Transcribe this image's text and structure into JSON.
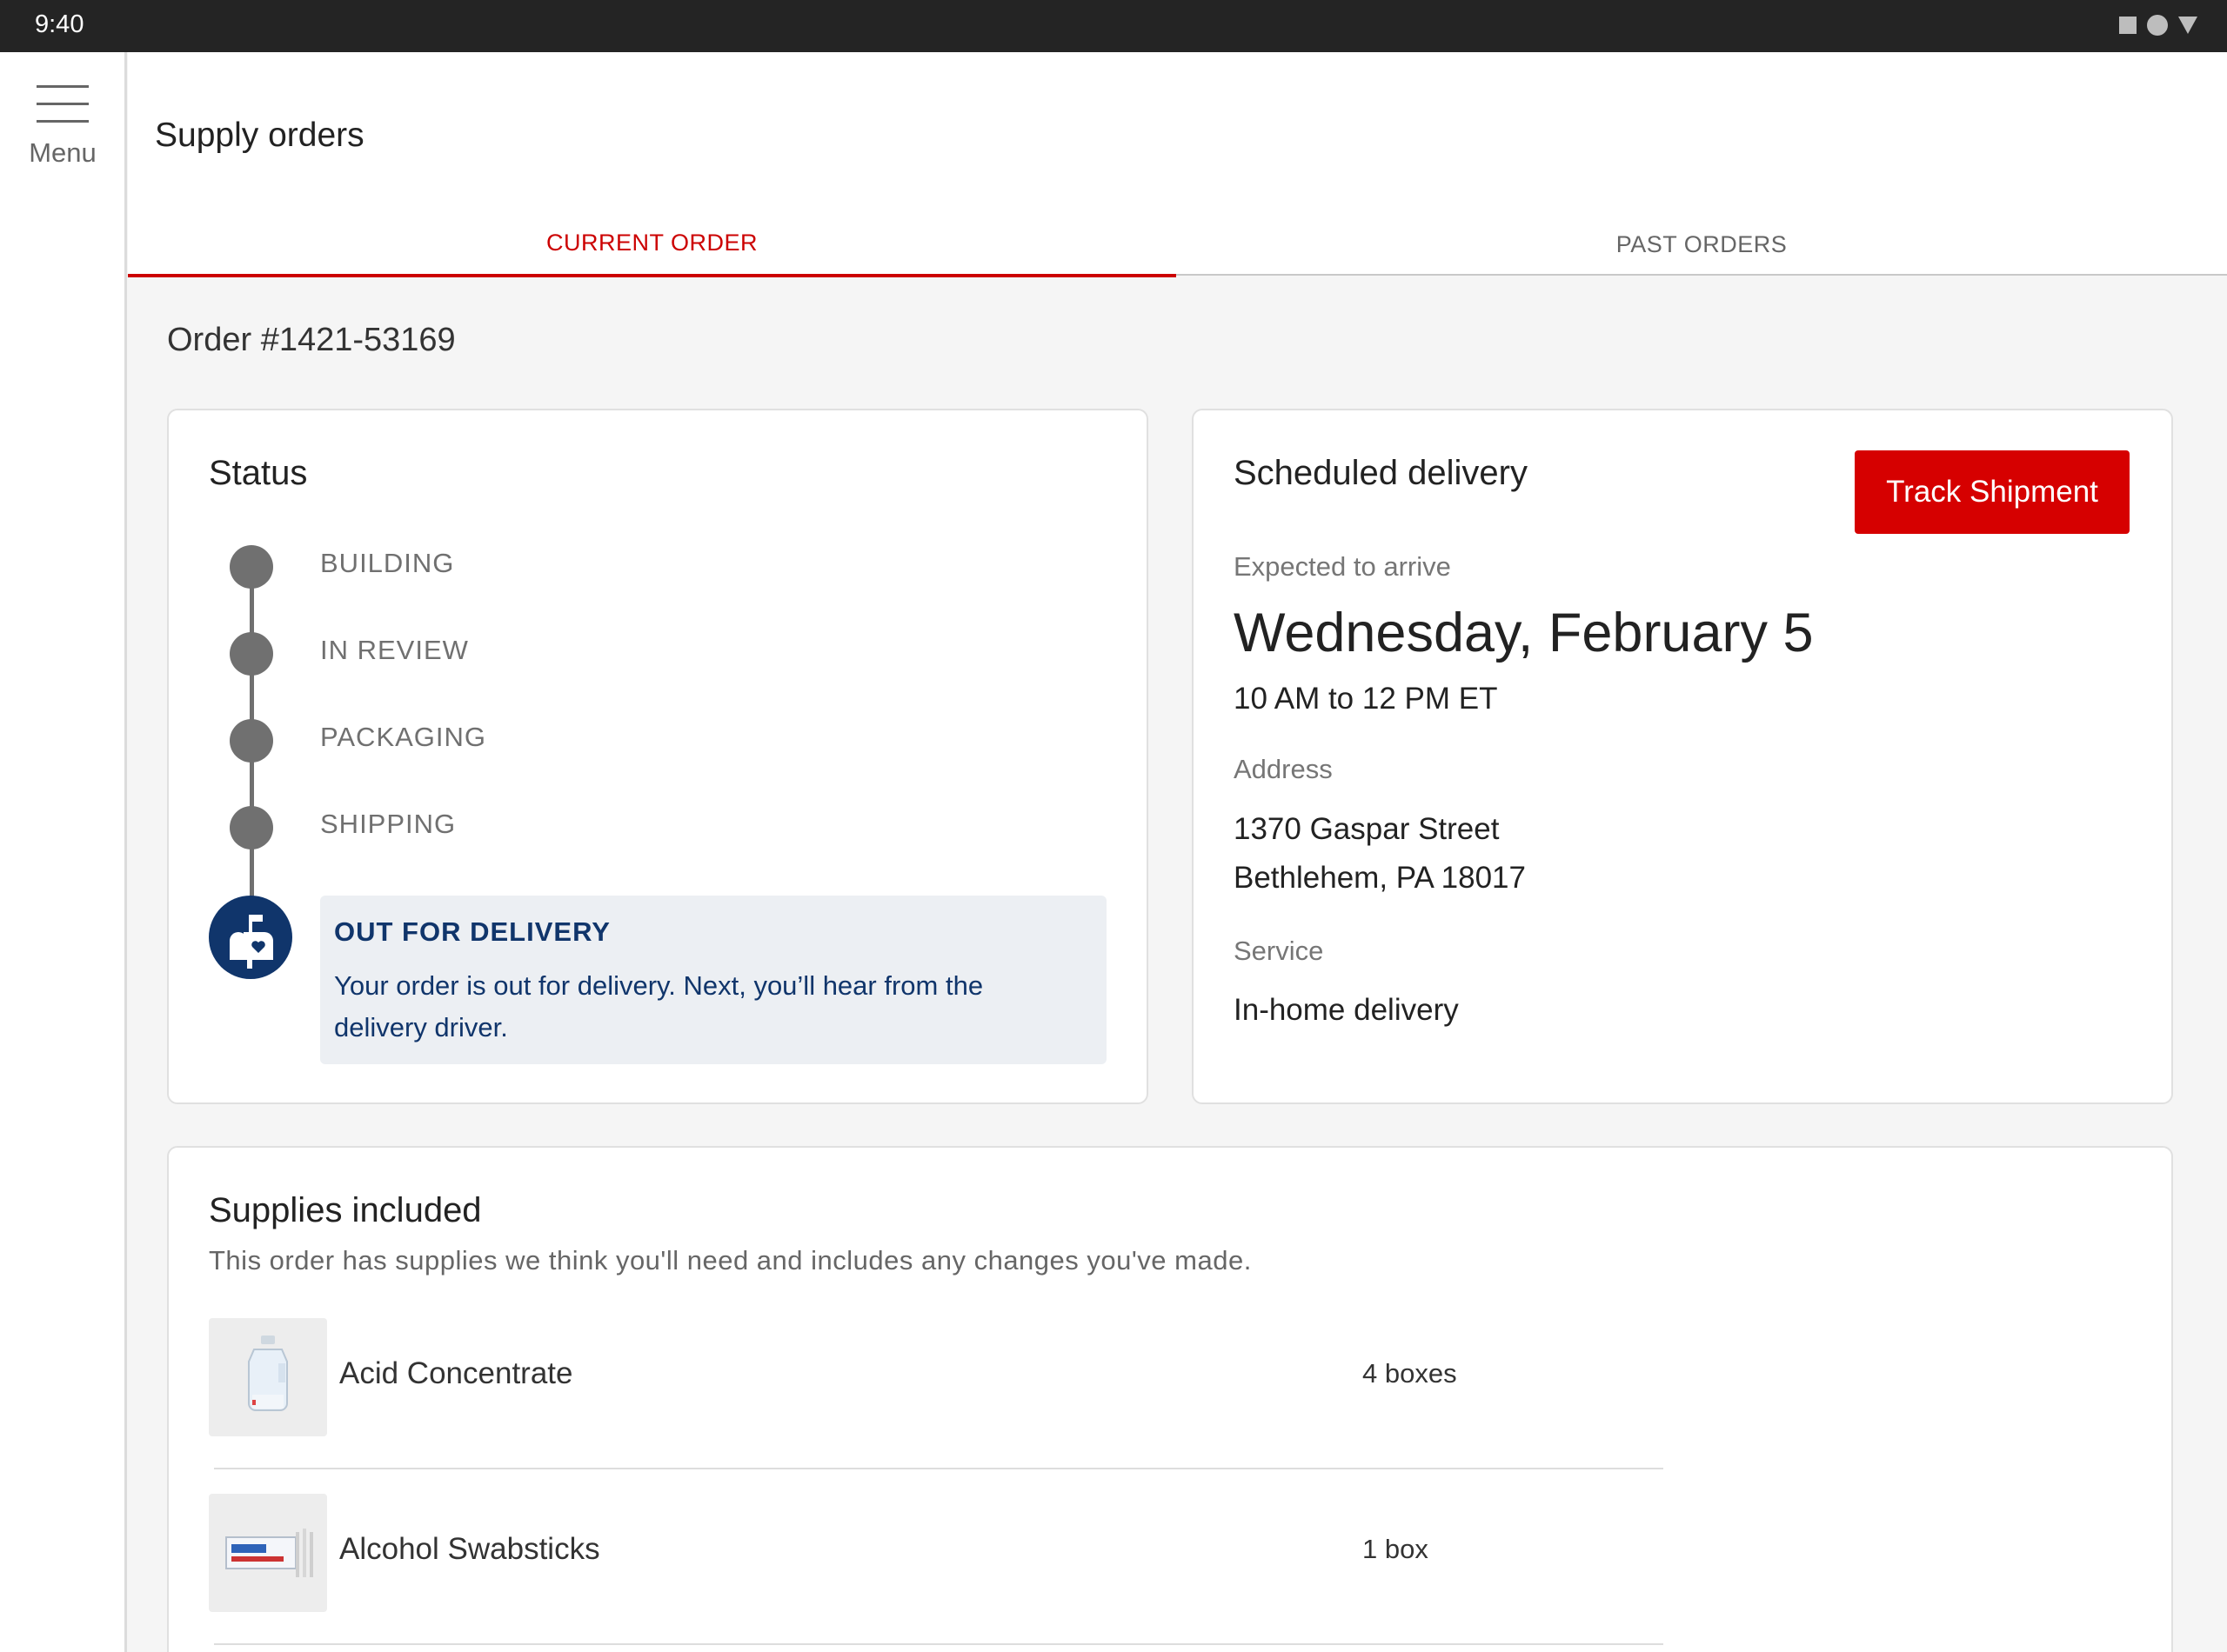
{
  "status_bar": {
    "time": "9:40"
  },
  "menu": {
    "label": "Menu"
  },
  "header": {
    "title": "Supply orders"
  },
  "tabs": [
    {
      "label": "CURRENT ORDER",
      "active": true
    },
    {
      "label": "PAST ORDERS",
      "active": false
    }
  ],
  "order": {
    "number": "Order #1421-53169"
  },
  "status": {
    "title": "Status",
    "steps": [
      "BUILDING",
      "IN REVIEW",
      "PACKAGING",
      "SHIPPING"
    ],
    "current": {
      "label": "OUT FOR DELIVERY",
      "description": "Your order is out for delivery. Next, you’ll hear from the delivery driver.",
      "icon": "mailbox-heart-icon"
    }
  },
  "delivery": {
    "title": "Scheduled delivery",
    "track_button": "Track Shipment",
    "expected_label": "Expected to arrive",
    "date": "Wednesday, February 5",
    "time_window": "10 AM to 12 PM ET",
    "address_label": "Address",
    "address_line1": "1370 Gaspar Street",
    "address_line2": "Bethlehem, PA 18017",
    "service_label": "Service",
    "service_value": "In-home delivery"
  },
  "supplies": {
    "title": "Supplies included",
    "subtitle": "This order has supplies we think you'll need and includes any changes you've made.",
    "items": [
      {
        "name": "Acid Concentrate",
        "quantity": "4 boxes",
        "icon": "jug-icon"
      },
      {
        "name": "Alcohol Swabsticks",
        "quantity": "1 box",
        "icon": "swabstick-box-icon"
      }
    ]
  },
  "colors": {
    "accent": "#cc0000",
    "button": "#d60000",
    "navy": "#10356b",
    "status_gray": "#707070"
  }
}
